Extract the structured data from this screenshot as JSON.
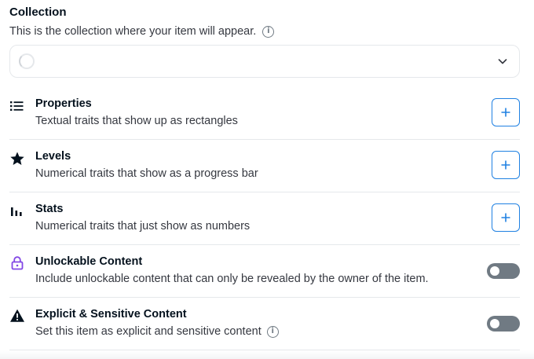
{
  "collection": {
    "title": "Collection",
    "description": "This is the collection where your item will appear.",
    "selected_value": ""
  },
  "rows": [
    {
      "title": "Properties",
      "description": "Textual traits that show up as rectangles",
      "icon": "list-icon",
      "control": "add-button"
    },
    {
      "title": "Levels",
      "description": "Numerical traits that show as a progress bar",
      "icon": "star-icon",
      "control": "add-button"
    },
    {
      "title": "Stats",
      "description": "Numerical traits that just show as numbers",
      "icon": "bar-chart-icon",
      "control": "add-button"
    },
    {
      "title": "Unlockable Content",
      "description": "Include unlockable content that can only be revealed by the owner of the item.",
      "icon": "lock-icon",
      "control": "toggle",
      "enabled": false
    },
    {
      "title": "Explicit & Sensitive Content",
      "description": "Set this item as explicit and sensitive content",
      "icon": "warning-icon",
      "control": "toggle",
      "enabled": false
    }
  ],
  "colors": {
    "accent": "#2081e2",
    "toggle_off": "#707a83",
    "border": "#e5e8eb",
    "title_text": "#04111d",
    "body_text": "#353840",
    "lock_icon": "#8247e5"
  }
}
